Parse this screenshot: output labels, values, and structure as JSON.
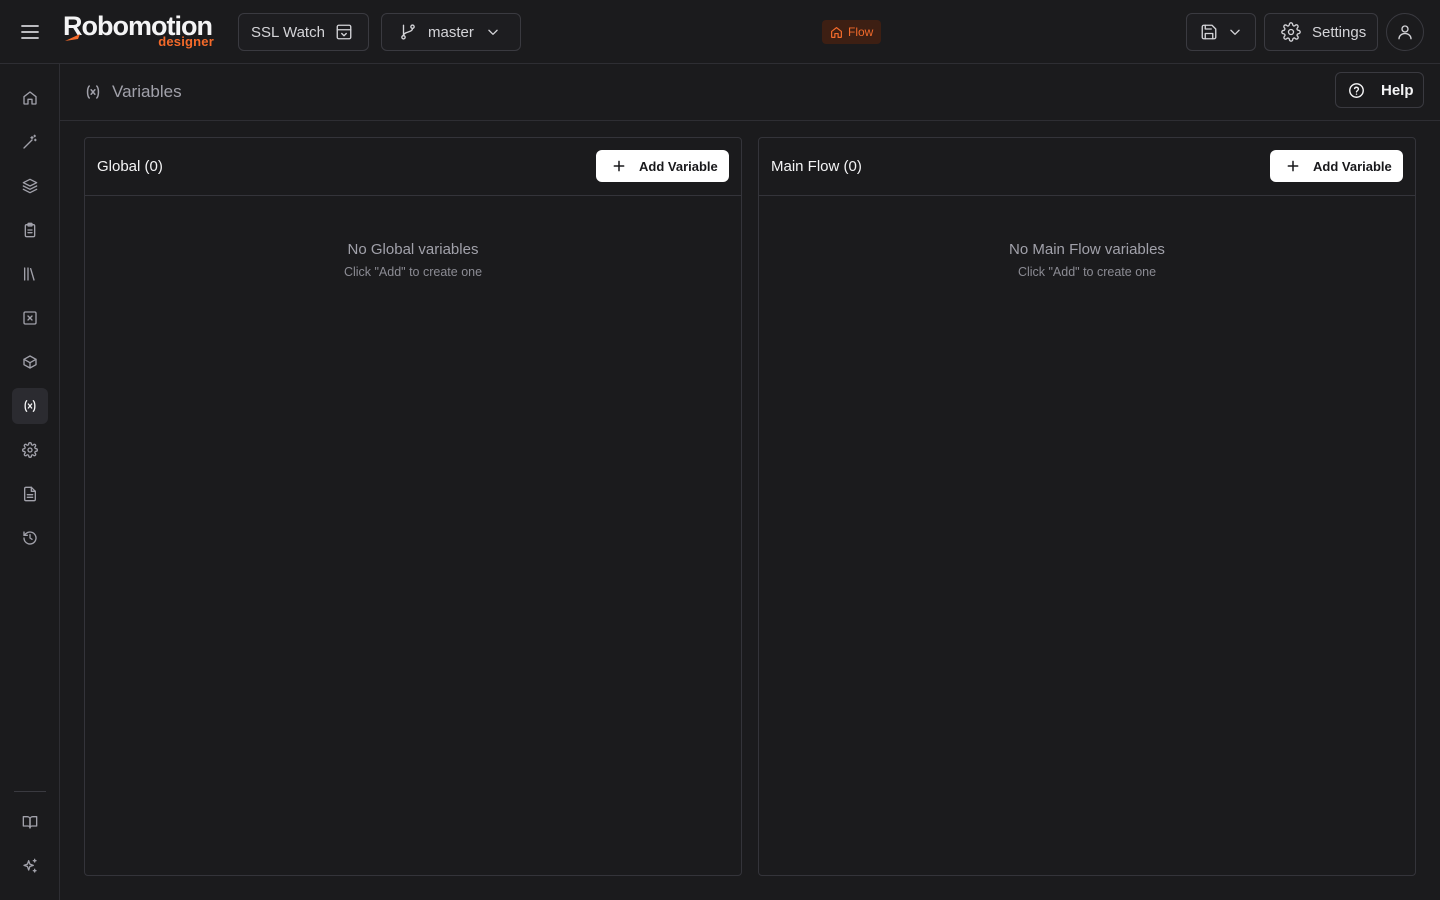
{
  "app": {
    "logo_main": "Robomotion",
    "logo_sub": "designer",
    "brand_color": "#f46a2a"
  },
  "topbar": {
    "project_name": "SSL Watch",
    "branch": "master",
    "badge_label": "Flow",
    "settings_label": "Settings",
    "icons": [
      "menu-icon",
      "archive-box-icon",
      "git-branch-icon",
      "chevron-down-icon",
      "home-icon",
      "save-icon",
      "gear-icon",
      "user-icon"
    ]
  },
  "sidebar": {
    "items": [
      {
        "icon": "home-icon",
        "active": false
      },
      {
        "icon": "magic-wand-icon",
        "active": false
      },
      {
        "icon": "layers-icon",
        "active": false
      },
      {
        "icon": "clipboard-icon",
        "active": false
      },
      {
        "icon": "library-icon",
        "active": false
      },
      {
        "icon": "x-square-icon",
        "active": false
      },
      {
        "icon": "package-icon",
        "active": false
      },
      {
        "icon": "variable-icon",
        "active": true
      },
      {
        "icon": "gear-icon",
        "active": false
      },
      {
        "icon": "file-text-icon",
        "active": false
      },
      {
        "icon": "history-icon",
        "active": false
      }
    ],
    "bottom_items": [
      {
        "icon": "book-open-icon"
      },
      {
        "icon": "sparkles-icon"
      }
    ]
  },
  "page": {
    "title": "Variables",
    "help_label": "Help"
  },
  "panels": {
    "global": {
      "title": "Global (0)",
      "add_label": "Add Variable",
      "empty_title": "No Global variables",
      "empty_hint": "Click \"Add\" to create one"
    },
    "main_flow": {
      "title": "Main Flow (0)",
      "add_label": "Add Variable",
      "empty_title": "No Main Flow variables",
      "empty_hint": "Click \"Add\" to create one"
    }
  }
}
